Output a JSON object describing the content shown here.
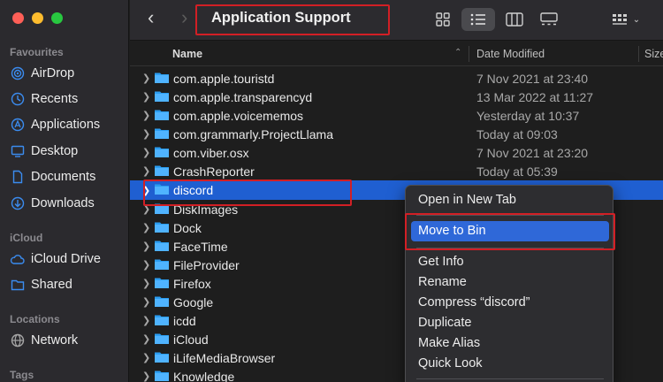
{
  "window": {
    "title": "Application Support"
  },
  "sidebar": {
    "favourites_label": "Favourites",
    "favourites": [
      {
        "label": "AirDrop",
        "icon": "airdrop-icon"
      },
      {
        "label": "Recents",
        "icon": "clock-icon"
      },
      {
        "label": "Applications",
        "icon": "applications-icon"
      },
      {
        "label": "Desktop",
        "icon": "desktop-icon"
      },
      {
        "label": "Documents",
        "icon": "document-icon"
      },
      {
        "label": "Downloads",
        "icon": "download-icon"
      }
    ],
    "icloud_label": "iCloud",
    "icloud": [
      {
        "label": "iCloud Drive",
        "icon": "cloud-icon"
      },
      {
        "label": "Shared",
        "icon": "shared-folder-icon"
      }
    ],
    "locations_label": "Locations",
    "locations": [
      {
        "label": "Network",
        "icon": "network-icon"
      }
    ],
    "tags_label": "Tags"
  },
  "columns": {
    "name": "Name",
    "date": "Date Modified",
    "size": "Size"
  },
  "files": [
    {
      "name": "com.apple.touristd",
      "date": "7 Nov 2021 at 23:40"
    },
    {
      "name": "com.apple.transparencyd",
      "date": "13 Mar 2022 at 11:27"
    },
    {
      "name": "com.apple.voicememos",
      "date": "Yesterday at 10:37"
    },
    {
      "name": "com.grammarly.ProjectLlama",
      "date": "Today at 09:03"
    },
    {
      "name": "com.viber.osx",
      "date": "7 Nov 2021 at 23:20"
    },
    {
      "name": "CrashReporter",
      "date": "Today at 05:39"
    },
    {
      "name": "discord",
      "date": ""
    },
    {
      "name": "DiskImages",
      "date": ""
    },
    {
      "name": "Dock",
      "date": ""
    },
    {
      "name": "FaceTime",
      "date": ""
    },
    {
      "name": "FileProvider",
      "date": ""
    },
    {
      "name": "Firefox",
      "date": ""
    },
    {
      "name": "Google",
      "date": ""
    },
    {
      "name": "icdd",
      "date": ""
    },
    {
      "name": "iCloud",
      "date": ""
    },
    {
      "name": "iLifeMediaBrowser",
      "date": ""
    },
    {
      "name": "Knowledge",
      "date": ""
    }
  ],
  "context_menu": {
    "items": [
      "Open in New Tab",
      "Move to Bin",
      "Get Info",
      "Rename",
      "Compress “discord”",
      "Duplicate",
      "Make Alias",
      "Quick Look"
    ]
  },
  "colors": {
    "accent": "#1f5fd1",
    "highlight": "#d21f25",
    "folder": "#2a9cf0"
  }
}
